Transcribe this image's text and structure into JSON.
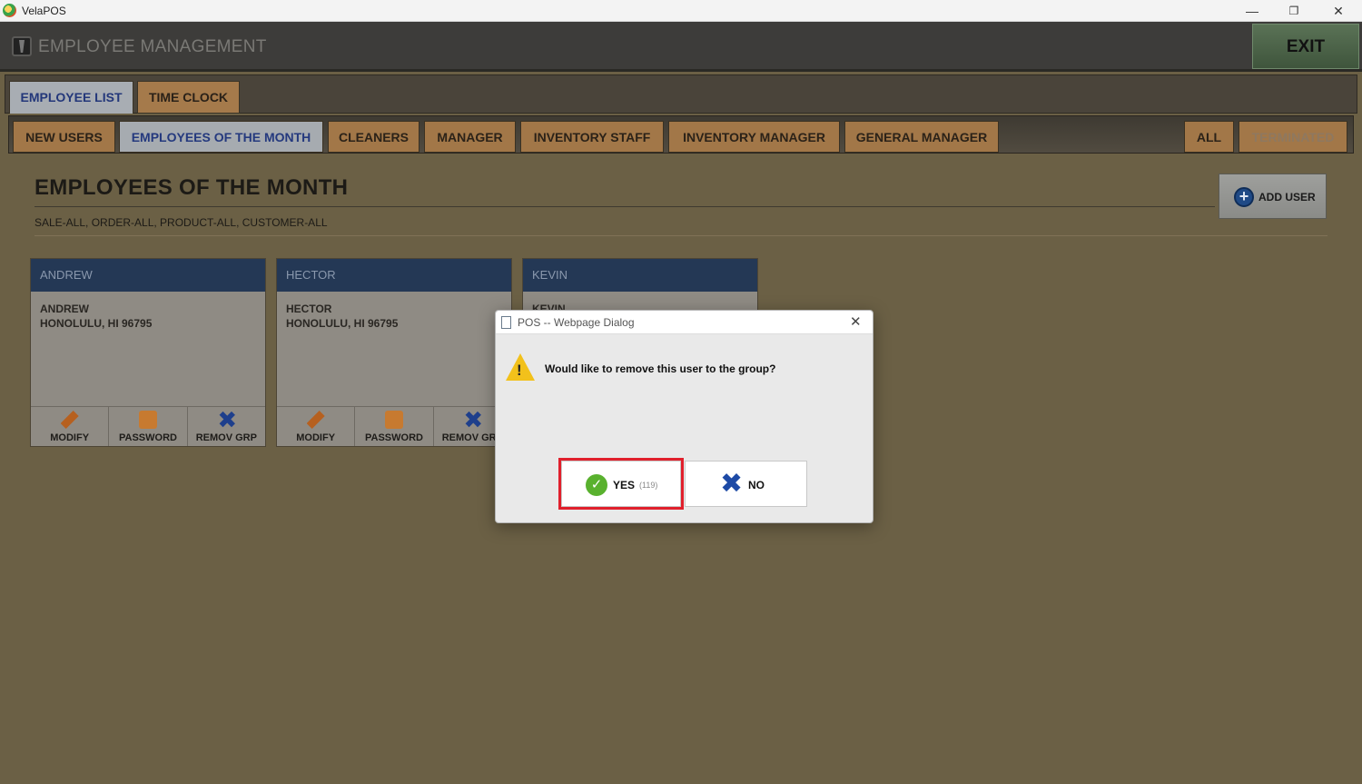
{
  "window": {
    "title": "VelaPOS",
    "minimize": "—",
    "maximize": "❐",
    "close": "✕"
  },
  "header": {
    "title": "EMPLOYEE MANAGEMENT",
    "exit_label": "EXIT"
  },
  "top_tabs": [
    "EMPLOYEE LIST",
    "TIME CLOCK"
  ],
  "group_tabs": [
    "NEW USERS",
    "EMPLOYEES OF THE MONTH",
    "CLEANERS",
    "MANAGER",
    "INVENTORY STAFF",
    "INVENTORY MANAGER",
    "GENERAL MANAGER",
    "ALL",
    "TERMINATED"
  ],
  "active_group": "EMPLOYEES OF THE MONTH",
  "page": {
    "title": "EMPLOYEES OF THE MONTH",
    "permissions": "SALE-ALL, ORDER-ALL, PRODUCT-ALL, CUSTOMER-ALL",
    "add_user_label": "ADD USER"
  },
  "employees": [
    {
      "header": "ANDREW",
      "name": "ANDREW",
      "address": "HONOLULU, HI 96795"
    },
    {
      "header": "HECTOR",
      "name": "HECTOR",
      "address": "HONOLULU, HI 96795"
    },
    {
      "header": "KEVIN",
      "name": "KEVIN",
      "address": ""
    }
  ],
  "card_actions": {
    "modify": "MODIFY",
    "password": "PASSWORD",
    "remove_group": "REMOV GRP"
  },
  "dialog": {
    "title": "POS -- Webpage Dialog",
    "message": "Would like to remove this user to the group?",
    "yes_label": "YES",
    "yes_countdown": "(119)",
    "no_label": "NO"
  },
  "colors": {
    "highlight_border": "#e0202c",
    "card_header": "#243855",
    "tab_active_text": "#24397e"
  }
}
